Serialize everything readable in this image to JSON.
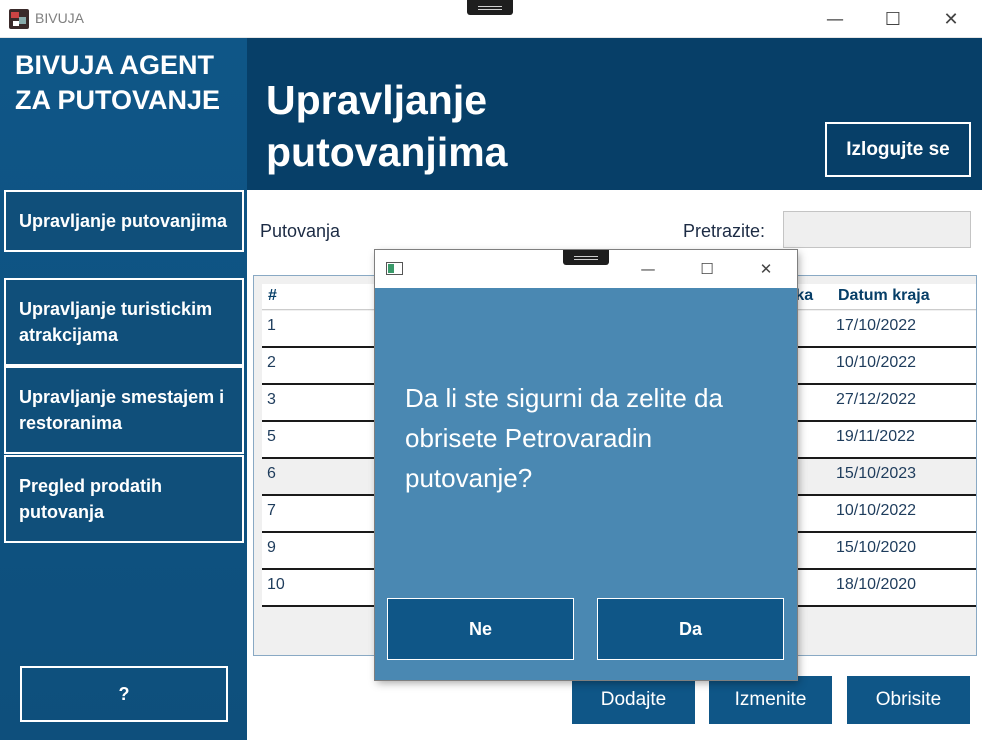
{
  "window": {
    "title": "BIVUJA",
    "minimize_glyph": "—",
    "maximize_glyph": "☐",
    "close_glyph": "✕"
  },
  "sidebar": {
    "brand": "BIVUJA AGENT ZA PUTOVANJE",
    "items": [
      {
        "label": "Upravljanje putovanjima"
      },
      {
        "label": "Upravljanje turistickim atrakcijama"
      },
      {
        "label": "Upravljanje smestajem i restoranima"
      },
      {
        "label": "Pregled prodatih putovanja"
      }
    ],
    "help_label": "?"
  },
  "header": {
    "title": "Upravljanje putovanjima",
    "logout_label": "Izlogujte se"
  },
  "main": {
    "list_label": "Putovanja",
    "search_label": "Pretrazite:",
    "search_value": "",
    "columns": {
      "id": "#",
      "start_partial": "tka",
      "end": "Datum kraja"
    },
    "rows": [
      {
        "id": "1",
        "end": "17/10/2022"
      },
      {
        "id": "2",
        "end": "10/10/2022"
      },
      {
        "id": "3",
        "end": "27/12/2022"
      },
      {
        "id": "5",
        "end": "19/11/2022"
      },
      {
        "id": "6",
        "end": "15/10/2023"
      },
      {
        "id": "7",
        "end": "10/10/2022"
      },
      {
        "id": "9",
        "end": "15/10/2020"
      },
      {
        "id": "10",
        "end": "18/10/2020"
      }
    ],
    "buttons": {
      "add": "Dodajte",
      "edit": "Izmenite",
      "delete": "Obrisite"
    }
  },
  "dialog": {
    "message": "Da li ste sigurni da zelite da obrisete Petrovaradin putovanje?",
    "no_label": "Ne",
    "yes_label": "Da",
    "minimize_glyph": "—",
    "maximize_glyph": "☐",
    "close_glyph": "✕"
  },
  "colors": {
    "sidebar": "#0f5687",
    "header": "#073f68",
    "dialog": "#4a88b2",
    "button": "#0f5687"
  }
}
